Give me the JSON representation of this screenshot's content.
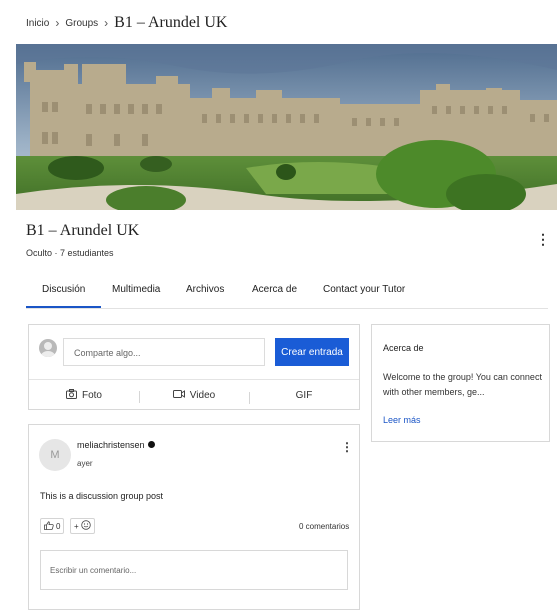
{
  "breadcrumb": {
    "items": [
      "Inicio",
      "Groups"
    ],
    "current": "B1 – Arundel UK"
  },
  "banner": {
    "image_description": "castle"
  },
  "group": {
    "title": "B1 – Arundel UK",
    "subtitle": "Oculto · 7 estudiantes"
  },
  "tabs": [
    "Discusión",
    "Multimedia",
    "Archivos",
    "Acerca de",
    "Contact your Tutor"
  ],
  "active_tab": "Discusión",
  "composer": {
    "placeholder": "Comparte algo...",
    "create_label": "Crear entrada",
    "photo_label": "Foto",
    "video_label": "Video",
    "gif_label": "GIF"
  },
  "about": {
    "title": "Acerca de",
    "body": "Welcome to the group! You can connect with other members, ge...",
    "read_more": "Leer más"
  },
  "post": {
    "avatar_initial": "M",
    "author": "meliachristensen",
    "time": "ayer",
    "body": "This is a discussion group post",
    "like_count": "0",
    "comments": "0 comentarios",
    "comment_placeholder": "Escribir un comentario..."
  },
  "colors": {
    "accent": "#1a5cd6",
    "border": "#d8d8d8"
  },
  "icons": [
    "chevron-right-icon",
    "kebab-icon",
    "camera-icon",
    "video-icon",
    "thumbs-up-icon",
    "emoji-icon",
    "verified-badge-icon"
  ]
}
